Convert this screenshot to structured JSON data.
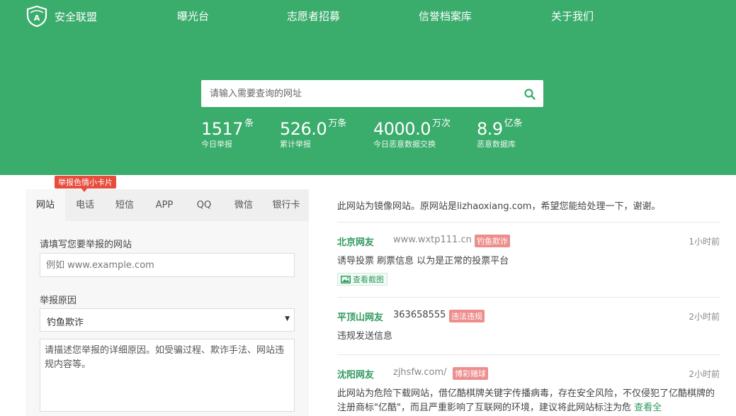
{
  "brand": {
    "name": "安全联盟",
    "logo_letter": "A",
    "accent": "#3aac6b"
  },
  "nav": [
    "曝光台",
    "志愿者招募",
    "信誉档案库",
    "关于我们"
  ],
  "search": {
    "placeholder": "请输入需要查询的网址",
    "icon": "search-icon"
  },
  "stats": [
    {
      "value": "1517",
      "unit": "条",
      "label": "今日举报"
    },
    {
      "value": "526.0",
      "unit": "万条",
      "label": "累计举报"
    },
    {
      "value": "4000.0",
      "unit": "万次",
      "label": "今日恶意数据交换"
    },
    {
      "value": "8.9",
      "unit": "亿条",
      "label": "恶意数据库"
    }
  ],
  "report": {
    "badge": "举报色情小卡片",
    "tabs": [
      "网站",
      "电话",
      "短信",
      "APP",
      "QQ",
      "微信",
      "银行卡"
    ],
    "active_tab": "网站",
    "site_label": "请填写您要举报的网站",
    "site_placeholder": "例如 www.example.com",
    "reason_label": "举报原因",
    "reason_value": "钓鱼欺诈",
    "detail_placeholder": "请描述您举报的详细原因。如受骗过程、欺诈手法、网站违规内容等。"
  },
  "notice": "此网站为镜像网站。原网站是lizhaoxiang.com，希望您能给处理一下，谢谢。",
  "feed": [
    {
      "user": "北京网友",
      "site": "www.wxtp111.cn",
      "tag": "钓鱼欺诈",
      "time": "1小时前",
      "desc": "诱导投票 刷票信息 以为是正常的投票平台",
      "button": "查看截图"
    },
    {
      "user": "平顶山网友",
      "site": "363658555",
      "tag": "违法违规",
      "time": "2小时前",
      "desc": "违规发送信息"
    },
    {
      "user": "沈阳网友",
      "site": "zjhsfw.com/",
      "tag": "博彩赌球",
      "time": "2小时前",
      "desc": "此网站为危险下载网站，借亿酷棋牌关键字传播病毒，存在安全风险，不仅侵犯了亿酷棋牌的注册商标\"亿酷\"，而且严重影响了互联网的环境，建议将此网站标注为危",
      "more": "查看全"
    }
  ]
}
